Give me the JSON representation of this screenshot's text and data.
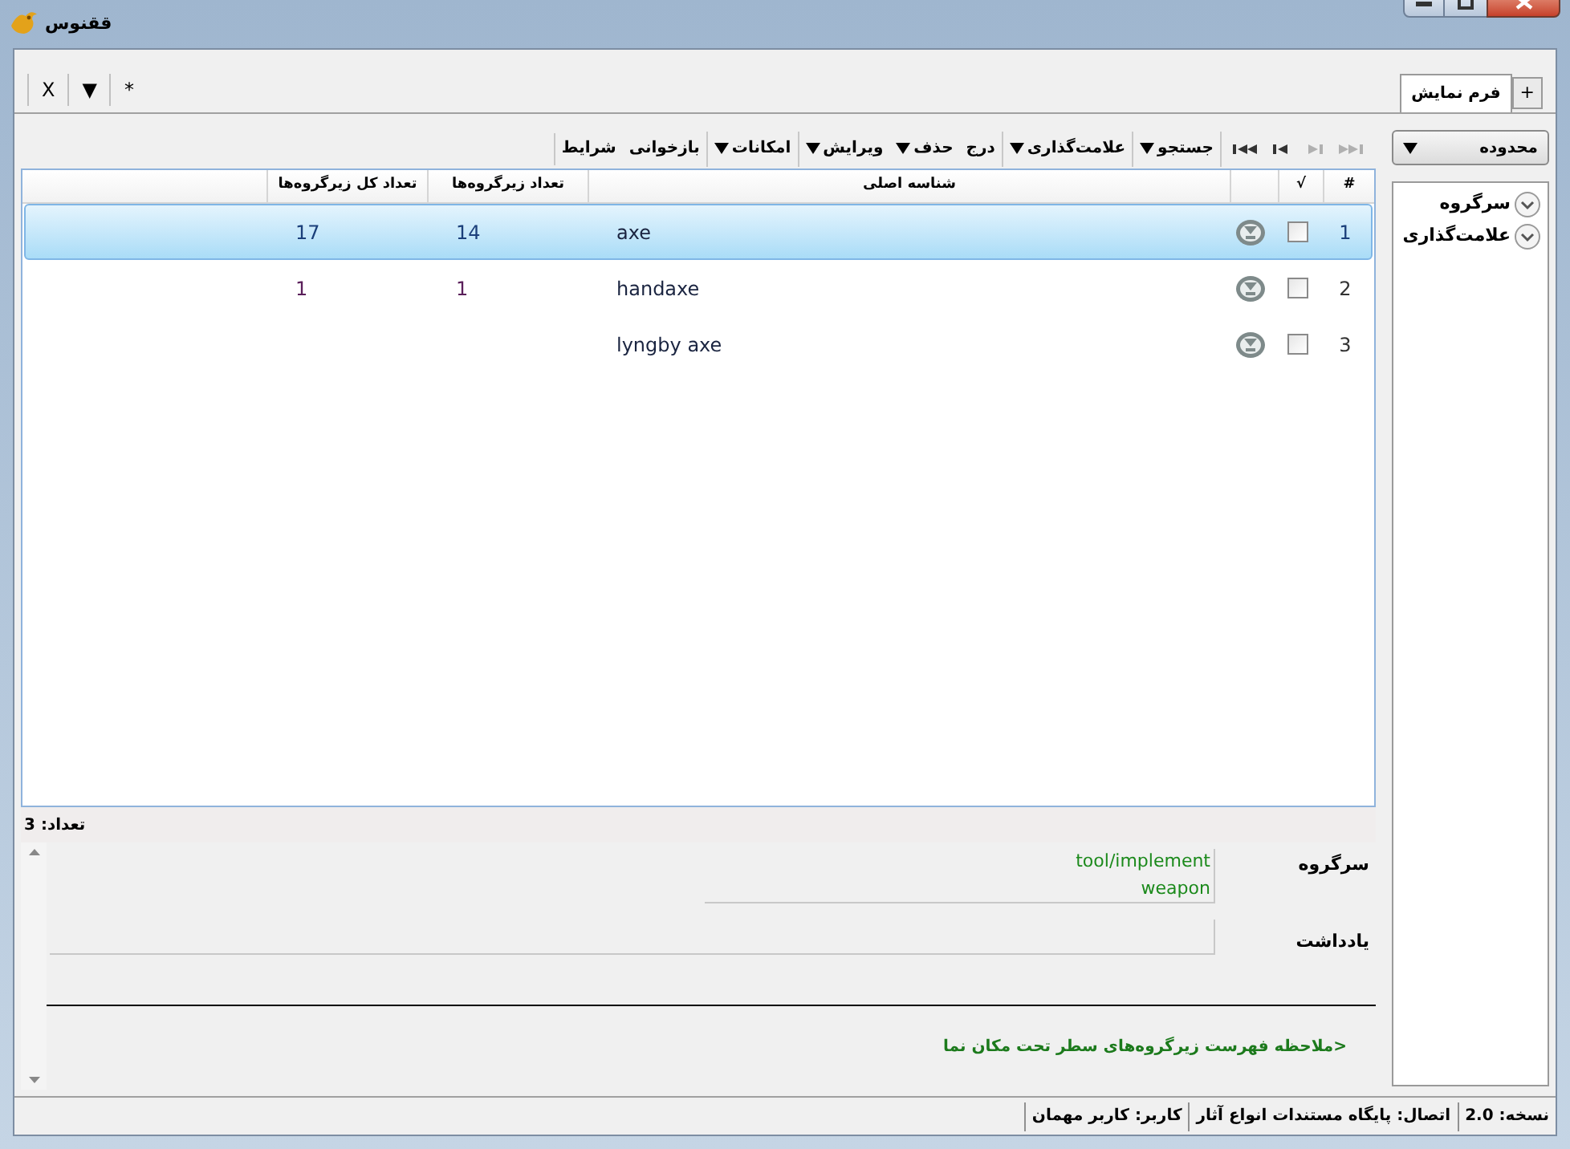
{
  "window": {
    "title": "ققنوس"
  },
  "doc_tabs": [
    {
      "label": "فرم نمایش",
      "selected": true
    }
  ],
  "tab_add": "+",
  "tab_actions": [
    "*",
    "▼",
    "X"
  ],
  "range_dropdown": {
    "value": "محدوده"
  },
  "tree": {
    "items": [
      {
        "label": "سرگروه",
        "expanded": false
      },
      {
        "label": "علامت‌گذاری",
        "expanded": false
      }
    ]
  },
  "nav_buttons": [
    {
      "kind": "first",
      "disabled": true
    },
    {
      "kind": "previous",
      "disabled": true
    },
    {
      "kind": "next",
      "disabled": false
    },
    {
      "kind": "last",
      "disabled": false
    }
  ],
  "toolbar": [
    {
      "label": "جستجو",
      "dropdown": true,
      "group_start": true
    },
    {
      "label": "علامت‌گذاری",
      "dropdown": true,
      "group_start": true
    },
    {
      "label": "درج",
      "dropdown": false,
      "group_start": true
    },
    {
      "label": "حذف",
      "dropdown": true,
      "group_start": false
    },
    {
      "label": "ویرایش",
      "dropdown": true,
      "group_start": false
    },
    {
      "label": "امکانات",
      "dropdown": true,
      "group_start": true
    },
    {
      "label": "بازخوانی",
      "dropdown": false,
      "group_start": true
    },
    {
      "label": "شرایط",
      "dropdown": false,
      "group_start": false
    }
  ],
  "table": {
    "columns": [
      "#",
      "√",
      "شناسه اصلی",
      "تعداد زیرگروه‌ها",
      "تعداد کل زیرگروه‌ها"
    ],
    "rows": [
      {
        "index": "1",
        "checked": false,
        "selected": true,
        "id": "axe",
        "subgroups": "14",
        "total_subgroups": "17"
      },
      {
        "index": "2",
        "checked": false,
        "selected": false,
        "id": "handaxe",
        "subgroups": "1",
        "total_subgroups": "1"
      },
      {
        "index": "3",
        "checked": false,
        "selected": false,
        "id": "lyngby axe"
      }
    ]
  },
  "count": "تعداد: 3",
  "details": {
    "parent_label": "سرگروه",
    "parent_values": [
      "tool/implement",
      "weapon"
    ],
    "note_label": "یادداشت"
  },
  "link": {
    "marker": ">",
    "text": "ملاحظه فهرست زیرگروه‌های سطر تحت مکان نما"
  },
  "status_bar": [
    "نسخه: 2.0",
    "اتصال: پایگاه مستندات انواع آثار",
    "کاربر: کاربر مهمان"
  ]
}
